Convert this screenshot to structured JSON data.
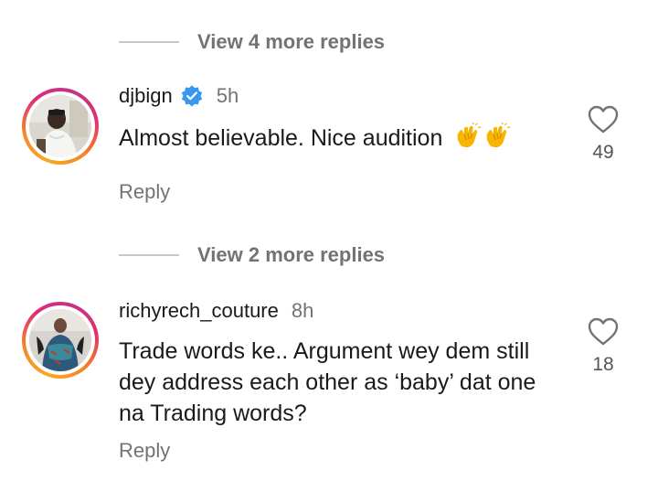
{
  "threads": [
    {
      "view_more": "View 4 more replies"
    },
    {
      "view_more": "View 2 more replies"
    }
  ],
  "comments": [
    {
      "username": "djbign",
      "verified": true,
      "time": "5h",
      "text": "Almost believable. Nice audition",
      "emoji": [
        "clapping-hands-icon",
        "clapping-hands-icon"
      ],
      "likes": "49",
      "reply_label": "Reply"
    },
    {
      "username": "richyrech_couture",
      "verified": false,
      "time": "8h",
      "text": "Trade words ke.. Argument wey dem still dey address each other as ‘baby’ dat one na Trading words?",
      "likes": "18",
      "reply_label": "Reply"
    }
  ],
  "colors": {
    "secondary_text": "#737373",
    "verified_blue": "#3897f0",
    "divider": "#c7c7c7"
  }
}
